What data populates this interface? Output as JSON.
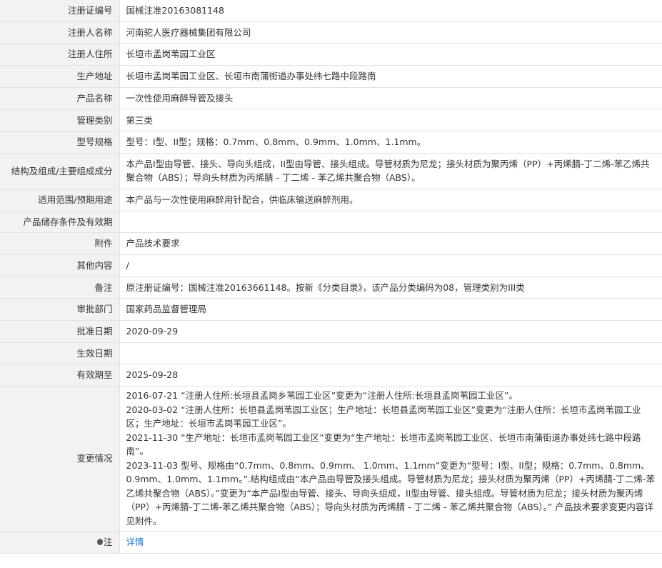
{
  "rows": [
    {
      "label": "注册证编号",
      "value": "国械注准20163081148"
    },
    {
      "label": "注册人名称",
      "value": "河南驼人医疗器械集团有限公司"
    },
    {
      "label": "注册人住所",
      "value": "长垣市孟岗苇园工业区"
    },
    {
      "label": "生产地址",
      "value": "长垣市孟岗苇园工业区、长垣市南蒲街道办事处纬七路中段路南"
    },
    {
      "label": "产品名称",
      "value": "一次性使用麻醉导管及接头"
    },
    {
      "label": "管理类别",
      "value": "第三类"
    },
    {
      "label": "型号规格",
      "value": "型号：I型、II型；规格：0.7mm、0.8mm、0.9mm、1.0mm、1.1mm。"
    },
    {
      "label": "结构及组成/主要组成成分",
      "value": "本产品I型由导管、接头、导向头组成，II型由导管、接头组成。导管材质为尼龙；接头材质为聚丙烯（PP）+丙烯腈-丁二烯-苯乙烯共聚合物（ABS）；导向头材质为丙烯腈 - 丁二烯 - 苯乙烯共聚合物（ABS）。"
    },
    {
      "label": "适用范围/预期用途",
      "value": "本产品与一次性使用麻醉用针配合，供临床输送麻醉剂用。"
    },
    {
      "label": "产品储存条件及有效期",
      "value": ""
    },
    {
      "label": "附件",
      "value": "产品技术要求"
    },
    {
      "label": "其他内容",
      "value": "/"
    },
    {
      "label": "备注",
      "value": "原注册证编号：国械注准20163661148。按新《分类目录》，该产品分类编码为08，管理类别为III类"
    },
    {
      "label": "审批部门",
      "value": "国家药品监督管理局"
    },
    {
      "label": "批准日期",
      "value": "2020-09-29"
    },
    {
      "label": "生效日期",
      "value": ""
    },
    {
      "label": "有效期至",
      "value": "2025-09-28"
    }
  ],
  "changes": {
    "label": "变更情况",
    "entries": [
      "2016-07-21 “注册人住所:长垣县孟岗乡苇园工业区”变更为“注册人住所:长垣县孟岗苇园工业区”。",
      "2020-03-02 “注册人住所：长垣县孟岗苇园工业区；生产地址：长垣县孟岗苇园工业区”变更为“注册人住所：长垣市孟岗苇园工业区；生产地址：长垣市孟岗苇园工业区”。",
      "2021-11-30 “生产地址：长垣市孟岗苇园工业区”变更为“生产地址：长垣市孟岗苇园工业区、长垣市南蒲街道办事处纬七路中段路南”。",
      "2023-11-03 型号、规格由“0.7mm、0.8mm、0.9mm、 1.0mm、1.1mm”变更为“型号：I型、II型；规格：0.7mm、0.8mm、0.9mm、1.0mm、1.1mm。”.结构组成由“本产品由导管及接头组成。导管材质为尼龙；接头材质为聚丙烯（PP）+丙烯腈-丁二烯-苯乙烯共聚合物（ABS）。”变更为“本产品I型由导管、接头、导向头组成，II型由导管、接头组成。导管材质为尼龙；接头材质为聚丙烯（PP）+丙烯腈-丁二烯-苯乙烯共聚合物（ABS）；导向头材质为丙烯腈 - 丁二烯 - 苯乙烯共聚合物（ABS）。” 产品技术要求变更内容详见附件。"
    ]
  },
  "note": {
    "label": "注",
    "icon": "pin-icon",
    "link_text": "详情",
    "link_color": "#1a73c8"
  }
}
